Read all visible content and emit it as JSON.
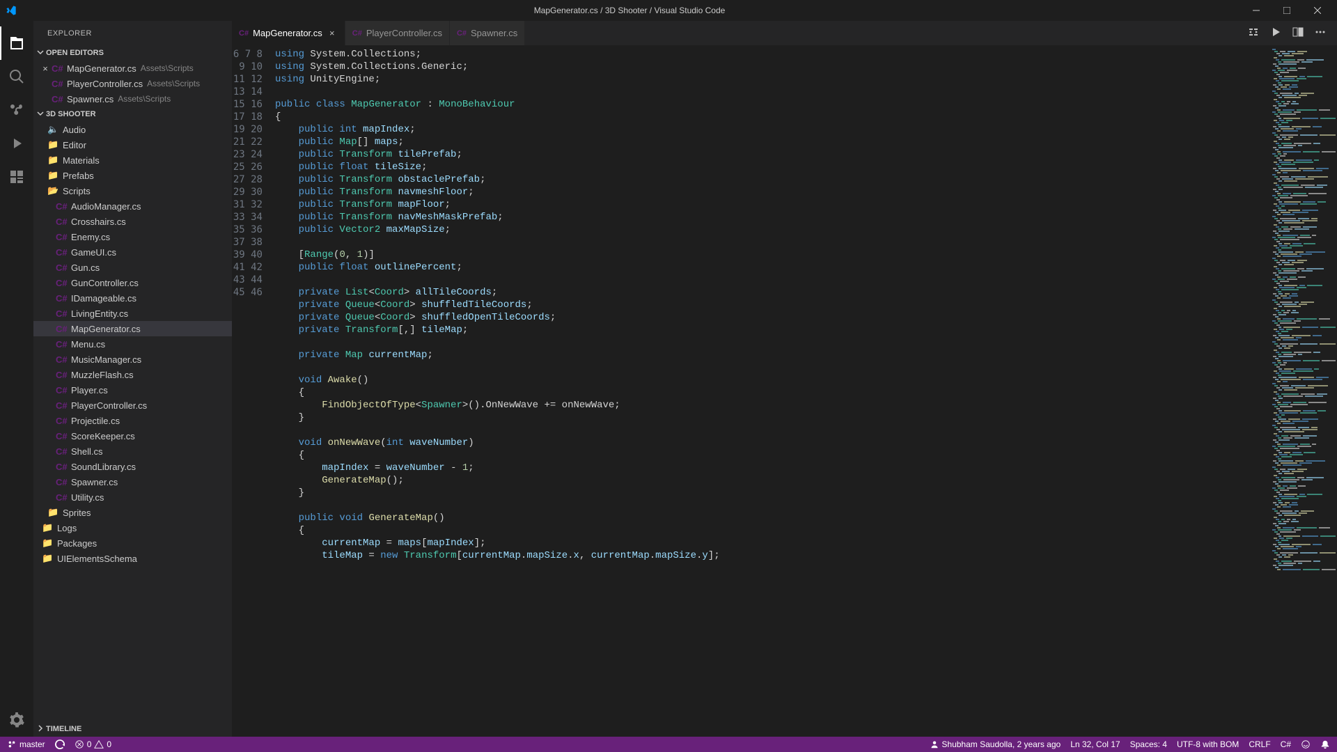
{
  "title": "MapGenerator.cs / 3D Shooter / Visual Studio Code",
  "sidebar": {
    "header": "EXPLORER",
    "open_editors_label": "OPEN EDITORS",
    "project_label": "3D SHOOTER",
    "timeline_label": "TIMELINE",
    "open_editors": [
      {
        "name": "MapGenerator.cs",
        "path": "Assets\\Scripts"
      },
      {
        "name": "PlayerController.cs",
        "path": "Assets\\Scripts"
      },
      {
        "name": "Spawner.cs",
        "path": "Assets\\Scripts"
      }
    ],
    "folders": [
      "Audio",
      "Editor",
      "Materials",
      "Prefabs"
    ],
    "scripts_folder": "Scripts",
    "scripts": [
      "AudioManager.cs",
      "Crosshairs.cs",
      "Enemy.cs",
      "GameUI.cs",
      "Gun.cs",
      "GunController.cs",
      "IDamageable.cs",
      "LivingEntity.cs",
      "MapGenerator.cs",
      "Menu.cs",
      "MusicManager.cs",
      "MuzzleFlash.cs",
      "Player.cs",
      "PlayerController.cs",
      "Projectile.cs",
      "ScoreKeeper.cs",
      "Shell.cs",
      "SoundLibrary.cs",
      "Spawner.cs",
      "Utility.cs"
    ],
    "after_scripts": [
      "Sprites"
    ],
    "root_folders": [
      "Logs",
      "Packages",
      "UIElementsSchema"
    ]
  },
  "tabs": [
    {
      "name": "MapGenerator.cs",
      "active": true
    },
    {
      "name": "PlayerController.cs",
      "active": false
    },
    {
      "name": "Spawner.cs",
      "active": false
    }
  ],
  "line_start": 6,
  "line_end": 46,
  "code": [
    [
      [
        "kw",
        "using"
      ],
      [
        "punct",
        " System.Collections;"
      ]
    ],
    [
      [
        "kw",
        "using"
      ],
      [
        "punct",
        " System.Collections.Generic;"
      ]
    ],
    [
      [
        "kw",
        "using"
      ],
      [
        "punct",
        " UnityEngine;"
      ]
    ],
    [],
    [
      [
        "kw",
        "public "
      ],
      [
        "kw",
        "class "
      ],
      [
        "type",
        "MapGenerator"
      ],
      [
        "punct",
        " : "
      ],
      [
        "type",
        "MonoBehaviour"
      ]
    ],
    [
      [
        "punct",
        "{"
      ]
    ],
    [
      [
        "punct",
        "    "
      ],
      [
        "kw",
        "public "
      ],
      [
        "kw",
        "int "
      ],
      [
        "var",
        "mapIndex"
      ],
      [
        "punct",
        ";"
      ]
    ],
    [
      [
        "punct",
        "    "
      ],
      [
        "kw",
        "public "
      ],
      [
        "type",
        "Map"
      ],
      [
        "punct",
        "[] "
      ],
      [
        "var",
        "maps"
      ],
      [
        "punct",
        ";"
      ]
    ],
    [
      [
        "punct",
        "    "
      ],
      [
        "kw",
        "public "
      ],
      [
        "type",
        "Transform "
      ],
      [
        "var",
        "tilePrefab"
      ],
      [
        "punct",
        ";"
      ]
    ],
    [
      [
        "punct",
        "    "
      ],
      [
        "kw",
        "public "
      ],
      [
        "kw",
        "float "
      ],
      [
        "var",
        "tileSize"
      ],
      [
        "punct",
        ";"
      ]
    ],
    [
      [
        "punct",
        "    "
      ],
      [
        "kw",
        "public "
      ],
      [
        "type",
        "Transform "
      ],
      [
        "var",
        "obstaclePrefab"
      ],
      [
        "punct",
        ";"
      ]
    ],
    [
      [
        "punct",
        "    "
      ],
      [
        "kw",
        "public "
      ],
      [
        "type",
        "Transform "
      ],
      [
        "var",
        "navmeshFloor"
      ],
      [
        "punct",
        ";"
      ]
    ],
    [
      [
        "punct",
        "    "
      ],
      [
        "kw",
        "public "
      ],
      [
        "type",
        "Transform "
      ],
      [
        "var",
        "mapFloor"
      ],
      [
        "punct",
        ";"
      ]
    ],
    [
      [
        "punct",
        "    "
      ],
      [
        "kw",
        "public "
      ],
      [
        "type",
        "Transform "
      ],
      [
        "var",
        "navMeshMaskPrefab"
      ],
      [
        "punct",
        ";"
      ]
    ],
    [
      [
        "punct",
        "    "
      ],
      [
        "kw",
        "public "
      ],
      [
        "type",
        "Vector2 "
      ],
      [
        "var",
        "maxMapSize"
      ],
      [
        "punct",
        ";"
      ]
    ],
    [],
    [
      [
        "punct",
        "    ["
      ],
      [
        "type",
        "Range"
      ],
      [
        "punct",
        "("
      ],
      [
        "num",
        "0"
      ],
      [
        "punct",
        ", "
      ],
      [
        "num",
        "1"
      ],
      [
        "punct",
        ")]"
      ]
    ],
    [
      [
        "punct",
        "    "
      ],
      [
        "kw",
        "public "
      ],
      [
        "kw",
        "float "
      ],
      [
        "var",
        "outlinePercent"
      ],
      [
        "punct",
        ";"
      ]
    ],
    [],
    [
      [
        "punct",
        "    "
      ],
      [
        "kw",
        "private "
      ],
      [
        "type",
        "List"
      ],
      [
        "punct",
        "<"
      ],
      [
        "type",
        "Coord"
      ],
      [
        "punct",
        "> "
      ],
      [
        "var",
        "allTileCoords"
      ],
      [
        "punct",
        ";"
      ]
    ],
    [
      [
        "punct",
        "    "
      ],
      [
        "kw",
        "private "
      ],
      [
        "type",
        "Queue"
      ],
      [
        "punct",
        "<"
      ],
      [
        "type",
        "Coord"
      ],
      [
        "punct",
        "> "
      ],
      [
        "var",
        "shuffledTileCoords"
      ],
      [
        "punct",
        ";"
      ]
    ],
    [
      [
        "punct",
        "    "
      ],
      [
        "kw",
        "private "
      ],
      [
        "type",
        "Queue"
      ],
      [
        "punct",
        "<"
      ],
      [
        "type",
        "Coord"
      ],
      [
        "punct",
        "> "
      ],
      [
        "var",
        "shuffledOpenTileCoords"
      ],
      [
        "punct",
        ";"
      ]
    ],
    [
      [
        "punct",
        "    "
      ],
      [
        "kw",
        "private "
      ],
      [
        "type",
        "Transform"
      ],
      [
        "punct",
        "[,] "
      ],
      [
        "var",
        "tileMap"
      ],
      [
        "punct",
        ";"
      ]
    ],
    [],
    [
      [
        "punct",
        "    "
      ],
      [
        "kw",
        "private "
      ],
      [
        "type",
        "Map "
      ],
      [
        "var",
        "currentMap"
      ],
      [
        "punct",
        ";"
      ]
    ],
    [],
    [
      [
        "punct",
        "    "
      ],
      [
        "kw",
        "void "
      ],
      [
        "method",
        "Awake"
      ],
      [
        "punct",
        "()"
      ]
    ],
    [
      [
        "punct",
        "    {"
      ]
    ],
    [
      [
        "punct",
        "        "
      ],
      [
        "method",
        "FindObjectOfType"
      ],
      [
        "punct",
        "<"
      ],
      [
        "type",
        "Spawner"
      ],
      [
        "punct",
        ">().OnNewWave += onNewWave;"
      ]
    ],
    [
      [
        "punct",
        "    }"
      ]
    ],
    [],
    [
      [
        "punct",
        "    "
      ],
      [
        "kw",
        "void "
      ],
      [
        "method",
        "onNewWave"
      ],
      [
        "punct",
        "("
      ],
      [
        "kw",
        "int "
      ],
      [
        "var",
        "waveNumber"
      ],
      [
        "punct",
        ")"
      ]
    ],
    [
      [
        "punct",
        "    {"
      ]
    ],
    [
      [
        "punct",
        "        "
      ],
      [
        "var",
        "mapIndex"
      ],
      [
        "punct",
        " = "
      ],
      [
        "var",
        "waveNumber"
      ],
      [
        "punct",
        " - "
      ],
      [
        "num",
        "1"
      ],
      [
        "punct",
        ";"
      ]
    ],
    [
      [
        "punct",
        "        "
      ],
      [
        "method",
        "GenerateMap"
      ],
      [
        "punct",
        "();"
      ]
    ],
    [
      [
        "punct",
        "    }"
      ]
    ],
    [],
    [
      [
        "punct",
        "    "
      ],
      [
        "kw",
        "public "
      ],
      [
        "kw",
        "void "
      ],
      [
        "method",
        "GenerateMap"
      ],
      [
        "punct",
        "()"
      ]
    ],
    [
      [
        "punct",
        "    {"
      ]
    ],
    [
      [
        "punct",
        "        "
      ],
      [
        "var",
        "currentMap"
      ],
      [
        "punct",
        " = "
      ],
      [
        "var",
        "maps"
      ],
      [
        "punct",
        "["
      ],
      [
        "var",
        "mapIndex"
      ],
      [
        "punct",
        "];"
      ]
    ],
    [
      [
        "punct",
        "        "
      ],
      [
        "var",
        "tileMap"
      ],
      [
        "punct",
        " = "
      ],
      [
        "kw",
        "new "
      ],
      [
        "type",
        "Transform"
      ],
      [
        "punct",
        "["
      ],
      [
        "var",
        "currentMap"
      ],
      [
        "punct",
        "."
      ],
      [
        "var",
        "mapSize"
      ],
      [
        "punct",
        "."
      ],
      [
        "var",
        "x"
      ],
      [
        "punct",
        ", "
      ],
      [
        "var",
        "currentMap"
      ],
      [
        "punct",
        "."
      ],
      [
        "var",
        "mapSize"
      ],
      [
        "punct",
        "."
      ],
      [
        "var",
        "y"
      ],
      [
        "punct",
        "];"
      ]
    ]
  ],
  "status": {
    "branch": "master",
    "sync": "",
    "errors": "0",
    "warnings": "0",
    "blame": "Shubham Saudolla, 2 years ago",
    "line": "Ln 32, Col 17",
    "spaces": "Spaces: 4",
    "encoding": "UTF-8 with BOM",
    "eol": "CRLF",
    "lang": "C#"
  }
}
